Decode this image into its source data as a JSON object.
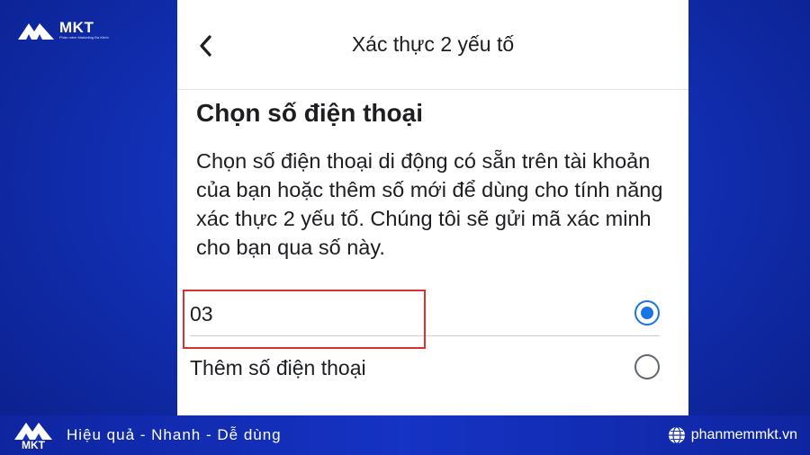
{
  "branding": {
    "brand": "MKT",
    "tagline": "Phần mềm Marketing Đa Kênh",
    "slogan": "Hiệu quả - Nhanh - Dễ dùng",
    "website": "phanmemmkt.vn"
  },
  "header": {
    "title": "Xác thực 2 yếu tố"
  },
  "main": {
    "heading": "Chọn số điện thoại",
    "description": "Chọn số điện thoại di động có sẵn trên tài khoản của bạn hoặc thêm số mới để dùng cho tính năng xác thực 2 yếu tố. Chúng tôi sẽ gửi mã xác minh cho bạn qua số này.",
    "options": [
      {
        "label": "03",
        "selected": true
      },
      {
        "label": "Thêm số điện thoại",
        "selected": false
      }
    ]
  },
  "colors": {
    "accent": "#1b74e4",
    "highlight": "#d9322f",
    "background": "#1230b5"
  }
}
